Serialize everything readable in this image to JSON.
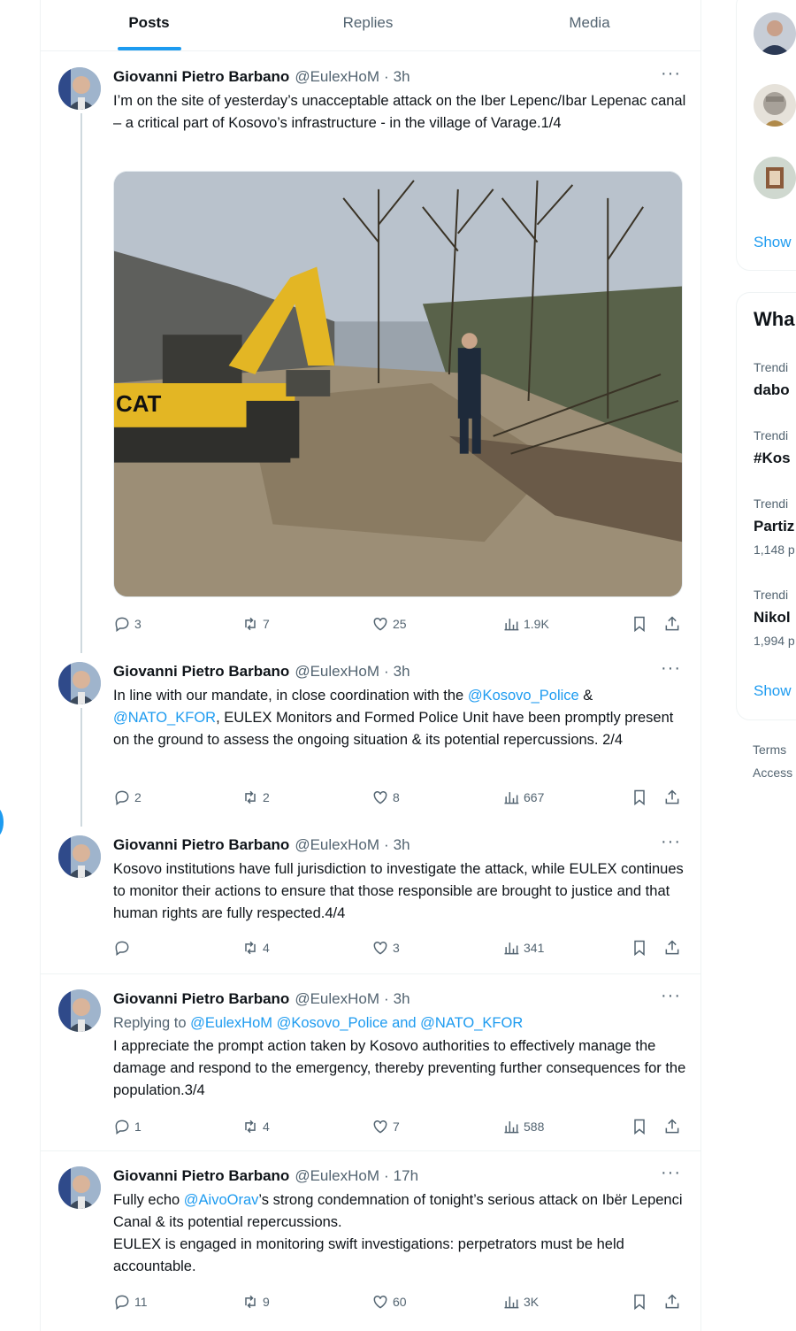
{
  "tabs": [
    {
      "label": "Posts",
      "active": true
    },
    {
      "label": "Replies",
      "active": false
    },
    {
      "label": "Media",
      "active": false
    }
  ],
  "author": {
    "name": "Giovanni Pietro Barbano",
    "handle": "@EulexHoM"
  },
  "tweets": [
    {
      "time": "3h",
      "text": "I’m on the site of yesterday’s unacceptable attack on the Iber Lepenc/Ibar Lepenac canal – a critical part of Kosovo’s infrastructure - in the village of Varage.1/4",
      "has_media": true,
      "replies": "3",
      "retweets": "7",
      "likes": "25",
      "views": "1.9K"
    },
    {
      "time": "3h",
      "text_parts": [
        "In line with our mandate, in close coordination with the ",
        "@Kosovo_Police",
        " & ",
        "@NATO_KFOR",
        ", EULEX Monitors and Formed Police Unit have been promptly present on the ground to assess the ongoing situation & its potential repercussions. 2/4"
      ],
      "replies": "2",
      "retweets": "2",
      "likes": "8",
      "views": "667"
    },
    {
      "time": "3h",
      "text": "Kosovo institutions have full jurisdiction to investigate the attack, while EULEX continues to monitor their actions to ensure that those responsible are brought to justice and that human rights are fully respected.4/4",
      "replies": "",
      "retweets": "4",
      "likes": "3",
      "views": "341"
    },
    {
      "time": "3h",
      "replying_prefix": "Replying to ",
      "replying_handles": "@EulexHoM @Kosovo_Police and @NATO_KFOR",
      "text": "I appreciate the prompt action taken by Kosovo authorities to effectively manage the damage and respond to the emergency, thereby preventing further consequences for the population.3/4",
      "replies": "1",
      "retweets": "4",
      "likes": "7",
      "views": "588"
    },
    {
      "time": "17h",
      "text_parts": [
        "Fully echo ",
        "@AivoOrav",
        "’s strong condemnation of tonight’s serious attack on Ibër Lepenci Canal & its potential repercussions."
      ],
      "text2": "EULEX is engaged in monitoring swift investigations: perpetrators must be held accountable.",
      "replies": "11",
      "retweets": "9",
      "likes": "60",
      "views": "3K"
    }
  ],
  "right": {
    "show_more_1": "Show",
    "what_title": "Wha",
    "trends": [
      {
        "label": "Trendi",
        "title": "dabo",
        "count": ""
      },
      {
        "label": "Trendi",
        "title": "#Kos",
        "count": ""
      },
      {
        "label": "Trendi",
        "title": "Partiz",
        "count": "1,148 p"
      },
      {
        "label": "Trendi",
        "title": "Nikol",
        "count": "1,994 p"
      }
    ],
    "show_more_2": "Show",
    "footer": [
      "Terms",
      "Access"
    ]
  },
  "colors": {
    "accent": "#1d9bf0",
    "muted": "#536471",
    "text": "#0f1419"
  },
  "icons": [
    "reply-icon",
    "retweet-icon",
    "like-icon",
    "views-icon",
    "bookmark-icon",
    "share-icon",
    "more-icon"
  ]
}
